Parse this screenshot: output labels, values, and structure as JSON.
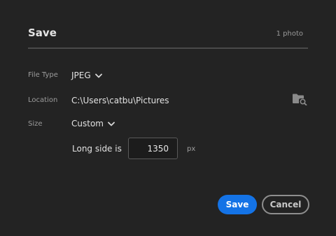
{
  "dialog": {
    "title": "Save",
    "count": "1 photo"
  },
  "fields": {
    "file_type": {
      "label": "File Type",
      "value": "JPEG"
    },
    "location": {
      "label": "Location",
      "value": "C:\\Users\\catbu\\Pictures",
      "browse_icon": "folder-search-icon"
    },
    "size": {
      "label": "Size",
      "value": "Custom"
    },
    "long_side": {
      "label": "Long side is",
      "value": "1350",
      "unit": "px"
    }
  },
  "buttons": {
    "save_label": "Save",
    "cancel_label": "Cancel"
  },
  "colors": {
    "background": "#232323",
    "accent": "#1473e6",
    "text": "#e2e2e2",
    "muted": "#9c9c9c"
  }
}
